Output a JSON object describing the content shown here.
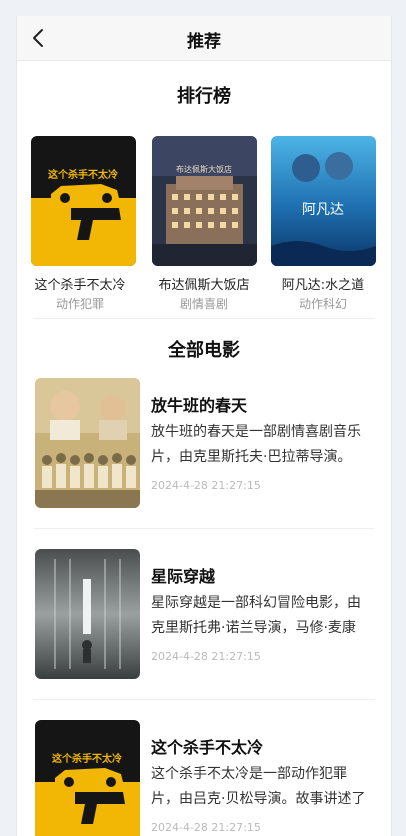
{
  "header": {
    "title": "推荐",
    "back_icon": "chevron-left-icon"
  },
  "ranking": {
    "title": "排行榜",
    "items": [
      {
        "name": "这个杀手不太冷",
        "genre": "动作犯罪",
        "poster_text": "这个杀手不太冷"
      },
      {
        "name": "布达佩斯大饭店",
        "genre": "剧情喜剧",
        "poster_text": "布达佩斯大饭店"
      },
      {
        "name": "阿凡达:水之道",
        "genre": "动作科幻",
        "poster_text": "阿凡达"
      }
    ]
  },
  "all_movies": {
    "title": "全部电影",
    "items": [
      {
        "name": "放牛班的春天",
        "desc": "放牛班的春天是一部剧情喜剧音乐片，由克里斯托夫·巴拉蒂导演。",
        "time": "2024-4-28 21:27:15"
      },
      {
        "name": "星际穿越",
        "desc": "星际穿越是一部科幻冒险电影，由克里斯托弗·诺兰导演，马修·麦康纳主演。",
        "time": "2024-4-28 21:27:15"
      },
      {
        "name": "这个杀手不太冷",
        "desc": "这个杀手不太冷是一部动作犯罪片，由吕克·贝松导演。故事讲述了一个杀手的故事。",
        "time": "2024-4-28 21:27:15"
      }
    ]
  },
  "colors": {
    "leon_yellow": "#f2b705",
    "leon_black": "#151515",
    "accent_text": "#111111"
  }
}
